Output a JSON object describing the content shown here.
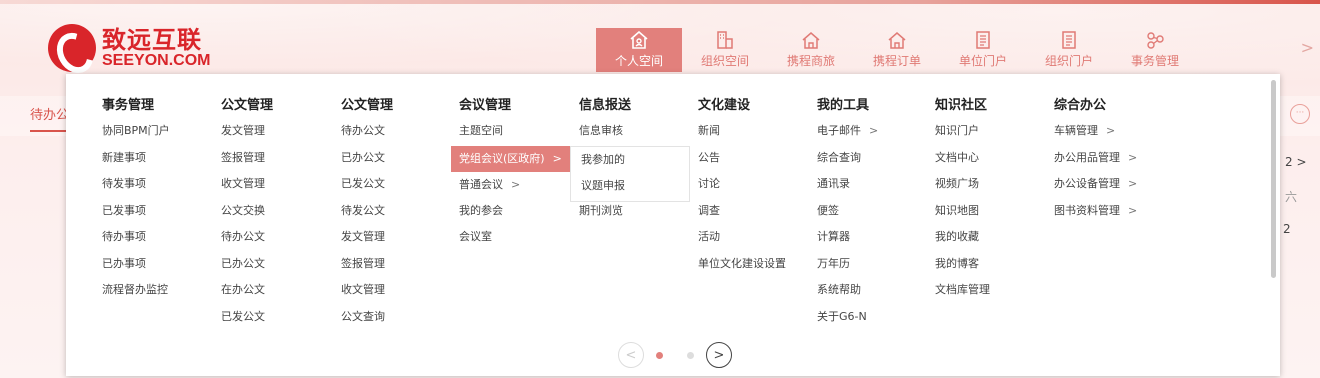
{
  "brand": {
    "name_cn": "致远互联",
    "name_en": "SEEYON.COM",
    "color": "#d9252a"
  },
  "nav": {
    "items": [
      {
        "label": "个人空间",
        "icon": "home-user-icon",
        "active": true
      },
      {
        "label": "组织空间",
        "icon": "building-icon",
        "active": false
      },
      {
        "label": "携程商旅",
        "icon": "home-icon",
        "active": false
      },
      {
        "label": "携程订单",
        "icon": "home-icon",
        "active": false
      },
      {
        "label": "单位门户",
        "icon": "document-icon",
        "active": false
      },
      {
        "label": "组织门户",
        "icon": "document-icon",
        "active": false
      },
      {
        "label": "事务管理",
        "icon": "flow-icon",
        "active": false
      }
    ],
    "more_arrow": ">"
  },
  "background": {
    "tab_label": "待办公",
    "right_text_1": "2  >",
    "right_text_2": "六",
    "right_text_3": "2"
  },
  "menu": {
    "columns": [
      {
        "title": "事务管理",
        "items": [
          "协同BPM门户",
          "新建事项",
          "待发事项",
          "已发事项",
          "待办事项",
          "已办事项",
          "流程督办监控"
        ]
      },
      {
        "title": "公文管理",
        "items": [
          "发文管理",
          "签报管理",
          "收文管理",
          "公文交换",
          "待办公文",
          "已办公文",
          "在办公文",
          "已发公文"
        ]
      },
      {
        "title": "公文管理",
        "items": [
          "待办公文",
          "已办公文",
          "已发公文",
          "待发公文",
          "发文管理",
          "签报管理",
          "收文管理",
          "公文查询"
        ]
      },
      {
        "title": "会议管理",
        "items": [
          "主题空间",
          "党组会议(区政府)",
          "普通会议",
          "我的参会",
          "会议室"
        ]
      },
      {
        "title": "信息报送",
        "items": [
          "信息审核",
          "",
          "",
          "期刊浏览"
        ]
      },
      {
        "title": "文化建设",
        "items": [
          "新闻",
          "公告",
          "讨论",
          "调查",
          "活动",
          "单位文化建设设置"
        ]
      },
      {
        "title": "我的工具",
        "items": [
          "电子邮件",
          "综合查询",
          "通讯录",
          "便签",
          "计算器",
          "万年历",
          "系统帮助",
          "关于G6-N"
        ]
      },
      {
        "title": "知识社区",
        "items": [
          "知识门户",
          "文档中心",
          "视频广场",
          "知识地图",
          "我的收藏",
          "我的博客",
          "文档库管理"
        ]
      },
      {
        "title": "综合办公",
        "items": [
          "车辆管理",
          "办公用品管理",
          "办公设备管理",
          "图书资料管理"
        ]
      }
    ],
    "submenu_items": [
      "我参加的",
      "议题申报"
    ],
    "chevron": ">",
    "pager": {
      "prev": "<",
      "next": ">",
      "current_page": 1,
      "total_pages": 2
    }
  }
}
